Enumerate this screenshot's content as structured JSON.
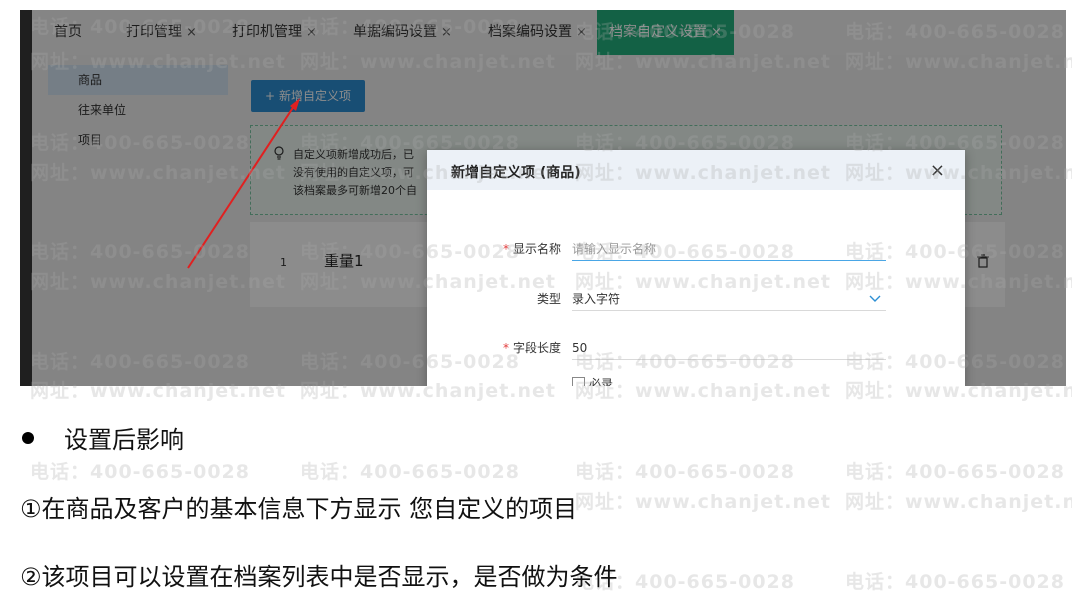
{
  "tabs": [
    {
      "label": "首页",
      "closable": false
    },
    {
      "label": "打印管理",
      "closable": true
    },
    {
      "label": "打印机管理",
      "closable": true
    },
    {
      "label": "单据编码设置",
      "closable": true
    },
    {
      "label": "档案编码设置",
      "closable": true
    },
    {
      "label": "档案自定义设置",
      "closable": true,
      "active": true
    }
  ],
  "close_glyph": "×",
  "sidebar": {
    "items": [
      {
        "label": "商品",
        "selected": true
      },
      {
        "label": "往来单位"
      },
      {
        "label": "项目"
      }
    ]
  },
  "add_button": {
    "icon": "+",
    "label": "新增自定义项"
  },
  "notice": {
    "icon": "lightbulb-icon",
    "lines": [
      "自定义项新增成功后，已",
      "没有使用的自定义项，可",
      "该档案最多可新增20个自"
    ]
  },
  "list": {
    "rows": [
      {
        "index": "1",
        "name": "重量1"
      }
    ]
  },
  "modal": {
    "title": "新增自定义项 (商品)",
    "close": "×",
    "fields": {
      "display_name": {
        "label": "显示名称",
        "required": true,
        "placeholder": "请输入显示名称"
      },
      "type": {
        "label": "类型",
        "value": "录入字符"
      },
      "field_length": {
        "label": "字段长度",
        "required": true,
        "value": "50"
      },
      "required_checkbox": {
        "label": "必录"
      }
    },
    "required_mark": "*"
  },
  "watermark": {
    "phone": "电话：400-665-0028",
    "site": "网址：www.chanjet.net"
  },
  "text": {
    "bullet": "设置后影响",
    "line1": "①在商品及客户的基本信息下方显示  您自定义的项目",
    "line2": "②该项目可以设置在档案列表中是否显示，是否做为条件"
  },
  "colors": {
    "active_tab": "#23b17f",
    "primary_button": "#2d8fd4",
    "annotation_arrow": "#e02020"
  }
}
